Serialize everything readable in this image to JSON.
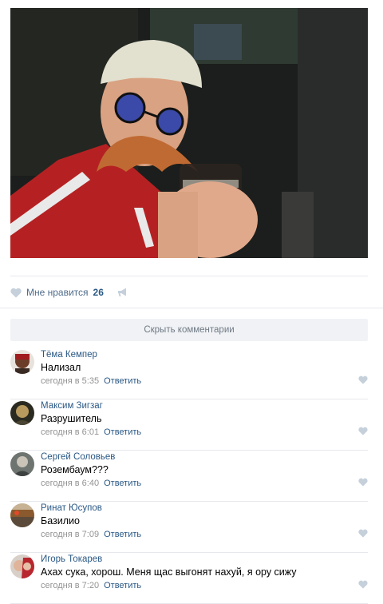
{
  "post": {
    "likes_label": "Мне нравится",
    "likes_count": "26",
    "hide_comments_label": "Скрыть комментарии"
  },
  "icons": {
    "like": "heart-icon",
    "share": "megaphone-icon",
    "comment_like": "heart-icon"
  },
  "colors": {
    "link": "#2a5885",
    "meta": "#939393",
    "icon": "#c5d0db"
  },
  "comments": [
    {
      "author": "Тёма Кемпер",
      "text": "Нализал",
      "time": "сегодня в 5:35",
      "reply": "Ответить"
    },
    {
      "author": "Максим Зигзаг",
      "text": "Разрушитель",
      "time": "сегодня в 6:01",
      "reply": "Ответить"
    },
    {
      "author": "Сергей Соловьев",
      "text": "Розембаум???",
      "time": "сегодня в 6:40",
      "reply": "Ответить"
    },
    {
      "author": "Ринат Юсупов",
      "text": "Базилио",
      "time": "сегодня в 7:09",
      "reply": "Ответить"
    },
    {
      "author": "Игорь Токарев",
      "text": "Ахах сука, хорош. Меня щас выгонят нахуй, я ору сижу",
      "time": "сегодня в 7:20",
      "reply": "Ответить"
    }
  ]
}
